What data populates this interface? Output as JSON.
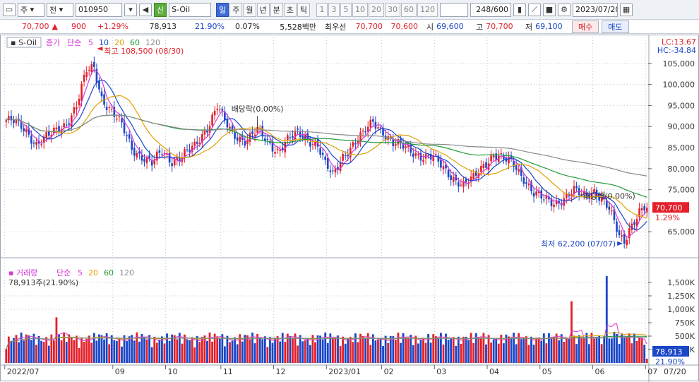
{
  "toolbar": {
    "type_label": "주",
    "market_label": "전",
    "code": "010950",
    "badge": "신",
    "name": "S-Oil",
    "periods": [
      "일",
      "주",
      "월",
      "년",
      "분",
      "초",
      "틱"
    ],
    "active_period": "일",
    "intervals": [
      "1",
      "3",
      "5",
      "10",
      "20",
      "30",
      "60",
      "120"
    ],
    "count": "248",
    "max_count": "/600",
    "date": "2023/07/20"
  },
  "quote": {
    "price": "70,700",
    "change": "900",
    "change_pct": "+1.29%",
    "volume": "78,913",
    "volume_ratio": "21.90%",
    "turnover": "0.07%",
    "amount": "5,528백만",
    "best_label": "최우선",
    "best_ask": "70,700",
    "best_bid": "70,600",
    "open_label": "시",
    "open": "69,600",
    "high_label": "고",
    "high": "70,700",
    "low_label": "저",
    "low": "69,100",
    "buy": "매수",
    "sell": "매도"
  },
  "price_panel": {
    "symbol": "S-Oil",
    "legend_type": "종가",
    "legend_method": "단순",
    "ma_periods": [
      "5",
      "10",
      "20",
      "60",
      "120"
    ],
    "lc": "LC:13.67",
    "hc": "HC:-34.84",
    "high_annotation": "최고 108,500 (08/30)",
    "low_annotation": "최저 62,200 (07/07)",
    "dividend_label": "배당락(0.00%)",
    "current_price": "70,700",
    "current_pct": "1.29%"
  },
  "volume_panel": {
    "title": "거래량",
    "method": "단순",
    "ma_periods": [
      "5",
      "20",
      "60",
      "120"
    ],
    "current": "78,913주(21.90%)",
    "current_value": "78,913",
    "current_pct": "21.90%"
  },
  "axis": {
    "x_labels": [
      "2022/07",
      "09",
      "10",
      "11",
      "12",
      "2023/01",
      "02",
      "03",
      "04",
      "05",
      "06",
      "07"
    ],
    "right_date": "07/20",
    "price_ticks": [
      "105,000",
      "100,000",
      "95,000",
      "90,000",
      "85,000",
      "80,000",
      "75,000",
      "65,000"
    ],
    "volume_ticks": [
      "1,500K",
      "1,250K",
      "1,000K",
      "750K",
      "500K",
      "250K"
    ]
  },
  "chart_data": {
    "type": "line",
    "price_anchors": [
      [
        0,
        91500
      ],
      [
        3,
        91000
      ],
      [
        8,
        89000
      ],
      [
        12,
        86000
      ],
      [
        18,
        88000
      ],
      [
        24,
        91000
      ],
      [
        28,
        95000
      ],
      [
        32,
        103000
      ],
      [
        35,
        104000
      ],
      [
        38,
        97000
      ],
      [
        42,
        93500
      ],
      [
        46,
        90000
      ],
      [
        50,
        85000
      ],
      [
        54,
        83000
      ],
      [
        58,
        81000
      ],
      [
        62,
        84000
      ],
      [
        66,
        82000
      ],
      [
        70,
        83000
      ],
      [
        75,
        85000
      ],
      [
        80,
        90000
      ],
      [
        84,
        95000
      ],
      [
        87,
        91000
      ],
      [
        90,
        88000
      ],
      [
        95,
        87000
      ],
      [
        100,
        89000
      ],
      [
        104,
        86000
      ],
      [
        108,
        84500
      ],
      [
        112,
        87000
      ],
      [
        116,
        88000
      ],
      [
        120,
        87000
      ],
      [
        124,
        86000
      ],
      [
        127,
        81000
      ],
      [
        130,
        78000
      ],
      [
        134,
        83000
      ],
      [
        138,
        86000
      ],
      [
        142,
        88000
      ],
      [
        146,
        91000
      ],
      [
        150,
        89000
      ],
      [
        154,
        86000
      ],
      [
        158,
        85000
      ],
      [
        162,
        84000
      ],
      [
        166,
        83000
      ],
      [
        170,
        82500
      ],
      [
        174,
        80000
      ],
      [
        178,
        78000
      ],
      [
        182,
        76000
      ],
      [
        186,
        77500
      ],
      [
        190,
        81000
      ],
      [
        194,
        83500
      ],
      [
        198,
        82000
      ],
      [
        202,
        81000
      ],
      [
        206,
        78000
      ],
      [
        210,
        74000
      ],
      [
        214,
        72500
      ],
      [
        218,
        72000
      ],
      [
        222,
        73000
      ],
      [
        226,
        74500
      ],
      [
        230,
        73500
      ],
      [
        234,
        75000
      ],
      [
        236,
        73500
      ],
      [
        238,
        72000
      ],
      [
        240,
        70000
      ],
      [
        242,
        67000
      ],
      [
        244,
        64000
      ],
      [
        246,
        63000
      ],
      [
        248,
        66000
      ],
      [
        252,
        69500
      ],
      [
        255,
        70700
      ]
    ],
    "ma_lines": [
      {
        "name": "5",
        "color": "#d63ad6"
      },
      {
        "name": "10",
        "color": "#1a46c8"
      },
      {
        "name": "20",
        "color": "#e0a100"
      },
      {
        "name": "60",
        "color": "#1f9b3a"
      },
      {
        "name": "120",
        "color": "#8a8a8a"
      }
    ],
    "y_range": [
      59500,
      109500
    ],
    "high": {
      "value": 108500,
      "date": "08/30"
    },
    "low": {
      "value": 62200,
      "date": "07/07"
    },
    "volume_range": [
      0,
      1750000
    ],
    "volume_spikes": [
      {
        "index": 20,
        "value": 850000
      },
      {
        "index": 225,
        "value": 1150000
      },
      {
        "index": 239,
        "value": 1620000
      },
      {
        "index": 242,
        "value": 580000
      },
      {
        "index": 220,
        "value": 420000
      },
      {
        "index": 190,
        "value": 560000
      }
    ]
  }
}
